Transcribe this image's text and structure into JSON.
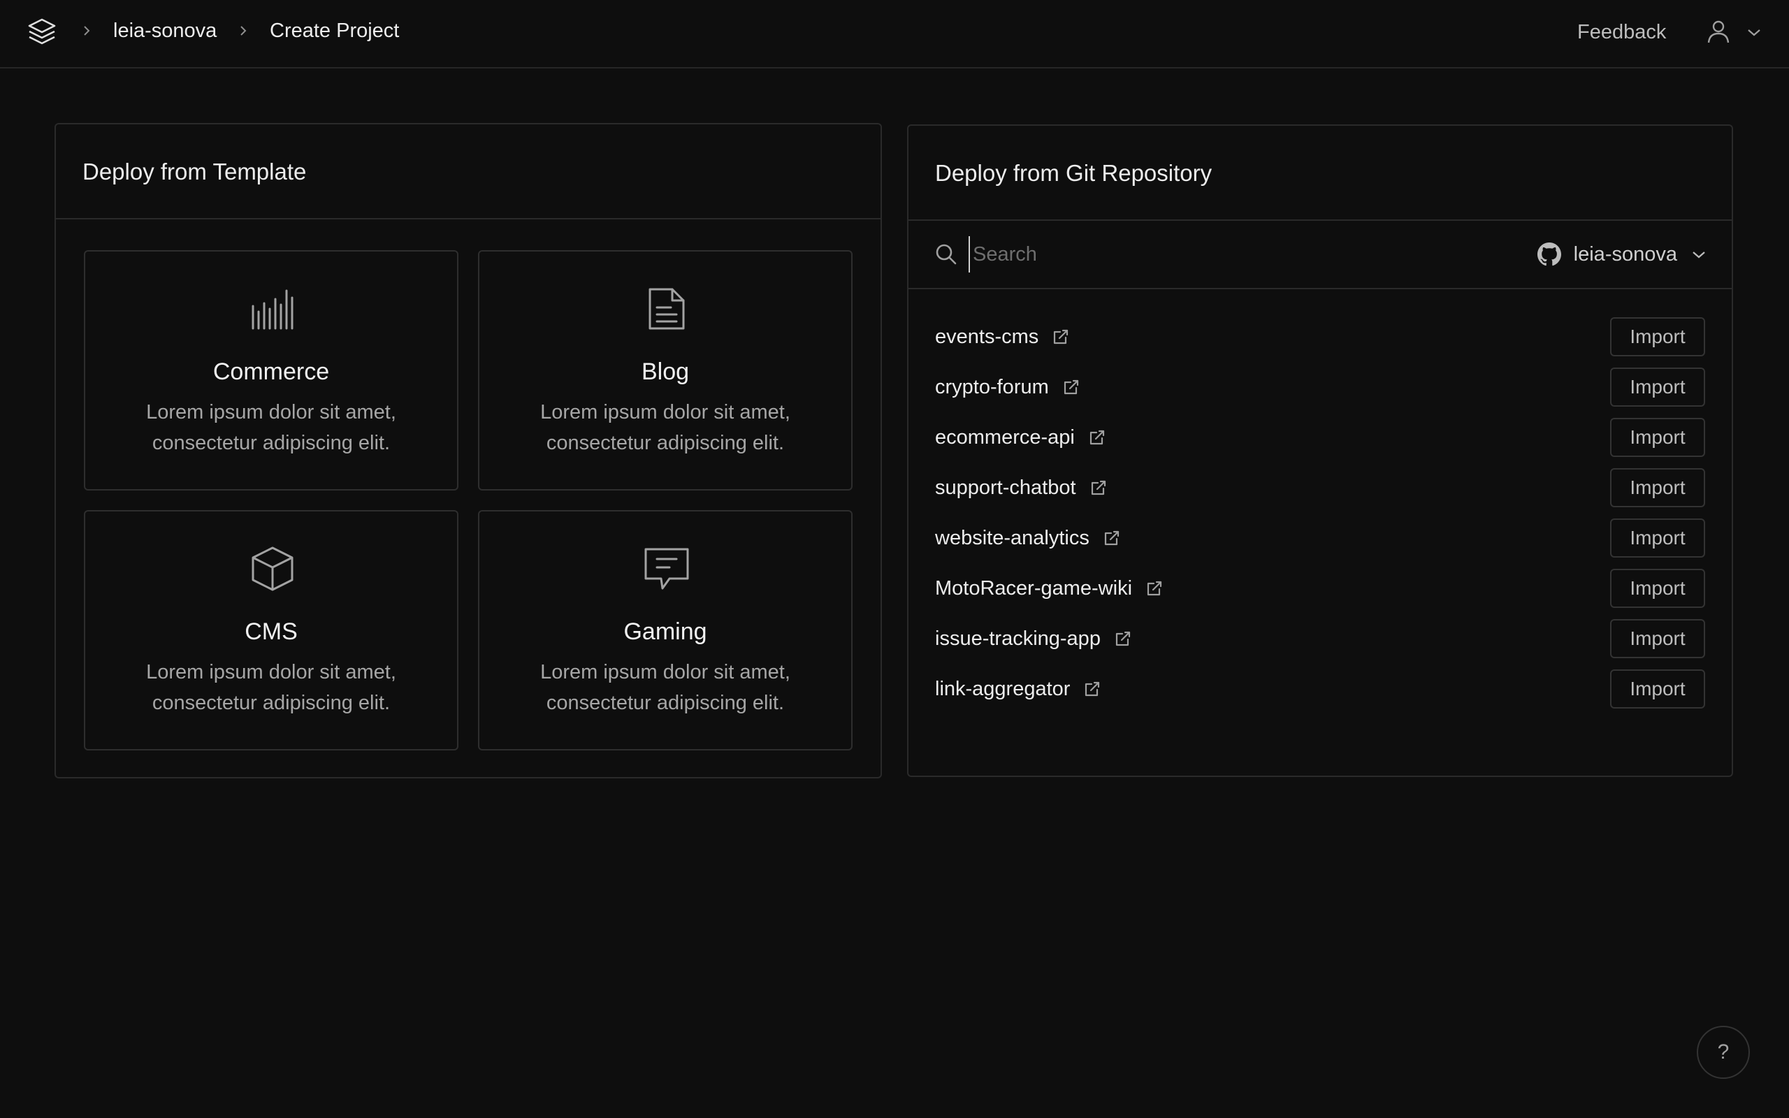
{
  "header": {
    "breadcrumb": [
      "leia-sonova",
      "Create Project"
    ],
    "feedback_label": "Feedback"
  },
  "templates": {
    "title": "Deploy from Template",
    "cards": [
      {
        "title": "Commerce",
        "description": "Lorem ipsum dolor sit amet, consectetur adipiscing elit.",
        "icon": "bar-chart-icon"
      },
      {
        "title": "Blog",
        "description": "Lorem ipsum dolor sit amet, consectetur adipiscing elit.",
        "icon": "document-icon"
      },
      {
        "title": "CMS",
        "description": "Lorem ipsum dolor sit amet, consectetur adipiscing elit.",
        "icon": "box-icon"
      },
      {
        "title": "Gaming",
        "description": "Lorem ipsum dolor sit amet, consectetur adipiscing elit.",
        "icon": "chat-bubble-icon"
      }
    ]
  },
  "git": {
    "title": "Deploy from Git Repository",
    "search_placeholder": "Search",
    "account": "leia-sonova",
    "import_label": "Import",
    "repos": [
      "events-cms",
      "crypto-forum",
      "ecommerce-api",
      "support-chatbot",
      "website-analytics",
      "MotoRacer-game-wiki",
      "issue-tracking-app",
      "link-aggregator"
    ]
  },
  "help": {
    "label": "?"
  },
  "colors": {
    "background": "#0e0e0e",
    "border": "#2a2a2a",
    "text": "#ededed",
    "muted": "#a6a6a6"
  }
}
